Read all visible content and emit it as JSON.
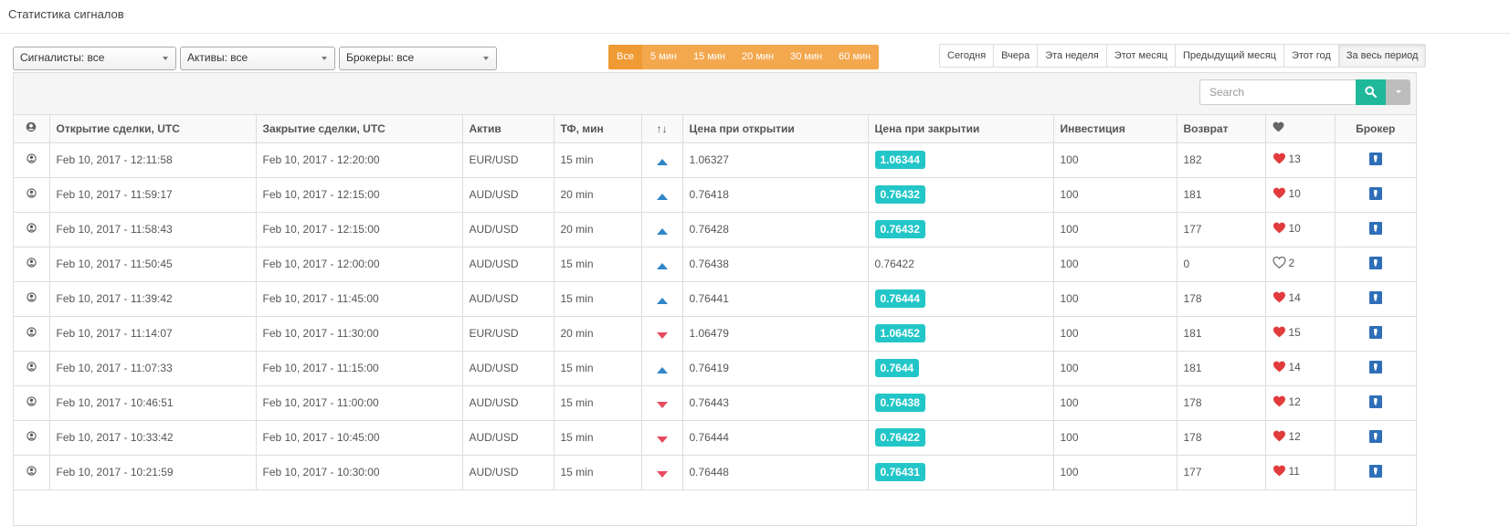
{
  "page": {
    "title": "Статистика сигналов"
  },
  "filters": {
    "signalers": "Сигналисты: все",
    "assets": "Активы: все",
    "brokers": "Брокеры: все"
  },
  "timeframes": [
    "Все",
    "5 мин",
    "15 мин",
    "20 мин",
    "30 мин",
    "60 мин"
  ],
  "timeframe_active": 0,
  "periods": [
    "Сегодня",
    "Вчера",
    "Эта неделя",
    "Этот месяц",
    "Предыдущий месяц",
    "Этот год",
    "За весь период"
  ],
  "period_active": 6,
  "search": {
    "placeholder": "Search"
  },
  "colors": {
    "accent_orange": "#f4a84e",
    "teal": "#23c6c8",
    "search_green": "#1fb89a",
    "up_blue": "#2f86c8",
    "down_red": "#e8495f",
    "heart_red": "#e23b3b"
  },
  "table": {
    "headers": {
      "user": "user-icon",
      "open": "Открытие сделки, UTC",
      "close": "Закрытие сделки, UTC",
      "asset": "Актив",
      "tf": "ТФ, мин",
      "dir": "↑↓",
      "price_open": "Цена при открытии",
      "price_close": "Цена при закрытии",
      "investment": "Инвестиция",
      "return": "Возврат",
      "fav": "heart-icon",
      "broker": "Брокер"
    },
    "rows": [
      {
        "open": "Feb 10, 2017 - 12:11:58",
        "close": "Feb 10, 2017 - 12:20:00",
        "asset": "EUR/USD",
        "tf": "15 min",
        "dir": "up",
        "price_open": "1.06327",
        "price_close": "1.06344",
        "win": true,
        "investment": "100",
        "return": "182",
        "fav_filled": true,
        "fav_count": "13"
      },
      {
        "open": "Feb 10, 2017 - 11:59:17",
        "close": "Feb 10, 2017 - 12:15:00",
        "asset": "AUD/USD",
        "tf": "20 min",
        "dir": "up",
        "price_open": "0.76418",
        "price_close": "0.76432",
        "win": true,
        "investment": "100",
        "return": "181",
        "fav_filled": true,
        "fav_count": "10"
      },
      {
        "open": "Feb 10, 2017 - 11:58:43",
        "close": "Feb 10, 2017 - 12:15:00",
        "asset": "AUD/USD",
        "tf": "20 min",
        "dir": "up",
        "price_open": "0.76428",
        "price_close": "0.76432",
        "win": true,
        "investment": "100",
        "return": "177",
        "fav_filled": true,
        "fav_count": "10"
      },
      {
        "open": "Feb 10, 2017 - 11:50:45",
        "close": "Feb 10, 2017 - 12:00:00",
        "asset": "AUD/USD",
        "tf": "15 min",
        "dir": "up",
        "price_open": "0.76438",
        "price_close": "0.76422",
        "win": false,
        "investment": "100",
        "return": "0",
        "fav_filled": false,
        "fav_count": "2"
      },
      {
        "open": "Feb 10, 2017 - 11:39:42",
        "close": "Feb 10, 2017 - 11:45:00",
        "asset": "AUD/USD",
        "tf": "15 min",
        "dir": "up",
        "price_open": "0.76441",
        "price_close": "0.76444",
        "win": true,
        "investment": "100",
        "return": "178",
        "fav_filled": true,
        "fav_count": "14"
      },
      {
        "open": "Feb 10, 2017 - 11:14:07",
        "close": "Feb 10, 2017 - 11:30:00",
        "asset": "EUR/USD",
        "tf": "20 min",
        "dir": "down",
        "price_open": "1.06479",
        "price_close": "1.06452",
        "win": true,
        "investment": "100",
        "return": "181",
        "fav_filled": true,
        "fav_count": "15"
      },
      {
        "open": "Feb 10, 2017 - 11:07:33",
        "close": "Feb 10, 2017 - 11:15:00",
        "asset": "AUD/USD",
        "tf": "15 min",
        "dir": "up",
        "price_open": "0.76419",
        "price_close": "0.7644",
        "win": true,
        "investment": "100",
        "return": "181",
        "fav_filled": true,
        "fav_count": "14"
      },
      {
        "open": "Feb 10, 2017 - 10:46:51",
        "close": "Feb 10, 2017 - 11:00:00",
        "asset": "AUD/USD",
        "tf": "15 min",
        "dir": "down",
        "price_open": "0.76443",
        "price_close": "0.76438",
        "win": true,
        "investment": "100",
        "return": "178",
        "fav_filled": true,
        "fav_count": "12"
      },
      {
        "open": "Feb 10, 2017 - 10:33:42",
        "close": "Feb 10, 2017 - 10:45:00",
        "asset": "AUD/USD",
        "tf": "15 min",
        "dir": "down",
        "price_open": "0.76444",
        "price_close": "0.76422",
        "win": true,
        "investment": "100",
        "return": "178",
        "fav_filled": true,
        "fav_count": "12"
      },
      {
        "open": "Feb 10, 2017 - 10:21:59",
        "close": "Feb 10, 2017 - 10:30:00",
        "asset": "AUD/USD",
        "tf": "15 min",
        "dir": "down",
        "price_open": "0.76448",
        "price_close": "0.76431",
        "win": true,
        "investment": "100",
        "return": "177",
        "fav_filled": true,
        "fav_count": "11"
      }
    ]
  }
}
